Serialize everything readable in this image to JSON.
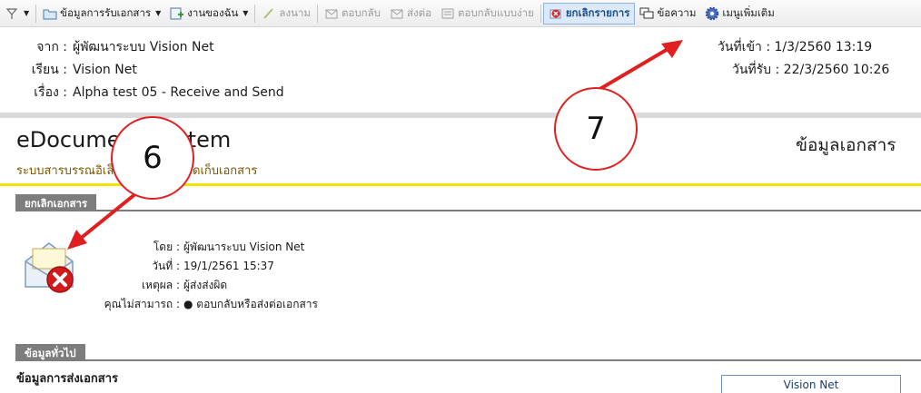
{
  "toolbar": {
    "items": [
      {
        "label": "ข้อมูลการรับเอกสาร",
        "icon": "folder-icon"
      },
      {
        "label": "งานของฉัน",
        "icon": "tasks-icon"
      },
      {
        "label": "ลงนาม",
        "icon": "sign-icon"
      },
      {
        "label": "ตอบกลับ",
        "icon": "reply-icon"
      },
      {
        "label": "ส่งต่อ",
        "icon": "forward-icon"
      },
      {
        "label": "ตอบกลับแบบง่าย",
        "icon": "simple-reply-icon"
      },
      {
        "label": "ยกเลิกรายการ",
        "icon": "cancel-icon"
      },
      {
        "label": "ข้อความ",
        "icon": "message-icon"
      },
      {
        "label": "เมนูเพิ่มเติม",
        "icon": "gear-icon"
      }
    ]
  },
  "header": {
    "from_label": "จาก :",
    "from": "ผู้พัฒนาระบบ Vision Net",
    "to_label": "เรียน :",
    "to": "Vision Net",
    "subject_label": "เรื่อง :",
    "subject": "Alpha test 05 - Receive and Send",
    "received_in": "วันที่เข้า : 1/3/2560 13:19",
    "received_on": "วันที่รับ : 22/3/2560 10:26"
  },
  "app": {
    "title": "eDocument System",
    "subtitle": "ระบบสารบรรณอิเล็กทรอนิกส์และจัดเก็บเอกสาร",
    "doc_info": "ข้อมูลเอกสาร"
  },
  "cancel_section": {
    "tab": "ยกเลิกเอกสาร",
    "by_label": "โดย :",
    "by": "ผู้พัฒนาระบบ Vision Net",
    "date_label": "วันที่ :",
    "date": "19/1/2561 15:37",
    "reason_label": "เหตุผล :",
    "reason": "ผู้ส่งส่งผิด",
    "cannot_label": "คุณไม่สามารถ :",
    "cannot": "●  ตอบกลับหรือส่งต่อเอกสาร"
  },
  "general_section": {
    "tab": "ข้อมูลทั่วไป",
    "heading": "ข้อมูลการส่งเอกสาร",
    "box": "Vision Net"
  },
  "annotations": {
    "callout_6": "6",
    "callout_7": "7"
  },
  "colors": {
    "accent_red": "#e02020",
    "yellow_line": "#f4e100",
    "section_gray": "#7d7d7d"
  }
}
